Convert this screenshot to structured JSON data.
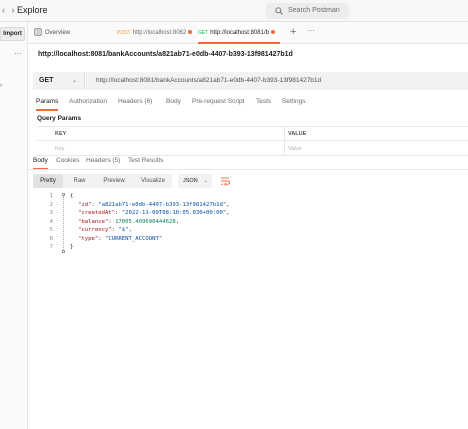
{
  "topbar": {
    "explore": "Explore",
    "search_placeholder": "Search Postman"
  },
  "sidebar": {
    "import_label": "Import",
    "more": "···"
  },
  "tabs": {
    "overview": "Overview",
    "items": [
      {
        "method": "POST",
        "label": "http://localhost:8062"
      },
      {
        "method": "GET",
        "label": "http://localhost:8081/b"
      }
    ],
    "new_tab": "+",
    "more": "···"
  },
  "request": {
    "title": "http://localhost:8081/bankAccounts/a821ab71-e0db-4407-b393-13f981427b1d",
    "method": "GET",
    "url": "http://localhost:8081/bankAccounts/a821ab71-e0db-4407-b393-13f981427b1d",
    "subtabs": [
      "Params",
      "Authorization",
      "Headers (6)",
      "Body",
      "Pre-request Script",
      "Tests",
      "Settings"
    ],
    "query_params_label": "Query Params",
    "params_table": {
      "col_key": "KEY",
      "col_value": "VALUE",
      "key_placeholder": "Key",
      "value_placeholder": "Value"
    }
  },
  "response": {
    "tabs": [
      "Body",
      "Cookies",
      "Headers (5)",
      "Test Results"
    ],
    "format_buttons": [
      "Pretty",
      "Raw",
      "Preview",
      "Visualize"
    ],
    "format": "JSON",
    "line_numbers": [
      "1",
      "2",
      "3",
      "4",
      "5",
      "6",
      "7"
    ],
    "body_lines": [
      {
        "kind": "open",
        "text": "{"
      },
      {
        "kind": "pair",
        "key": "\"id\"",
        "value": "\"a821ab71-e0db-4407-b393-13f981427b1d\"",
        "vtype": "s",
        "comma": ","
      },
      {
        "kind": "pair",
        "key": "\"createdAt\"",
        "value": "\"2022-11-09T08:10:05.030+00:00\"",
        "vtype": "s",
        "comma": ","
      },
      {
        "kind": "pair",
        "key": "\"balance\"",
        "value": "17005.409690444628",
        "vtype": "n",
        "comma": ","
      },
      {
        "kind": "pair",
        "key": "\"currency\"",
        "value": "\"$\"",
        "vtype": "s",
        "comma": ","
      },
      {
        "kind": "pair",
        "key": "\"type\"",
        "value": "\"CURRENT_ACCOUNT\"",
        "vtype": "s",
        "comma": ""
      },
      {
        "kind": "close",
        "text": "}"
      }
    ]
  },
  "colors": {
    "accent": "#f26b3a",
    "get_method": "#0cbb52",
    "post_method": "#e8a233",
    "json_key": "#a31515",
    "json_string": "#0451a5",
    "json_number": "#098658"
  }
}
